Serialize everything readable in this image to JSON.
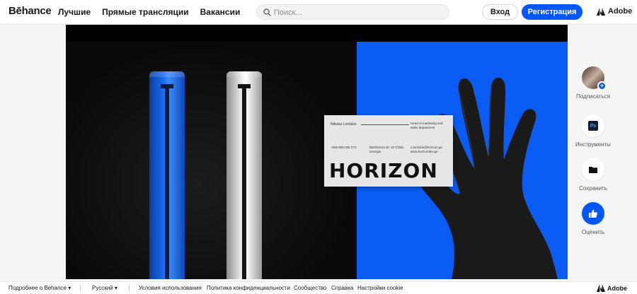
{
  "header": {
    "logo": "Bēhance",
    "nav": [
      "Лучшие",
      "Прямые трансляции",
      "Вакансии"
    ],
    "search_placeholder": "Поиск...",
    "login_label": "Вход",
    "register_label": "Регистрация",
    "adobe_label": "Adobe"
  },
  "artwork": {
    "card_name": "Nikolas Lomidze",
    "card_role": "Head of marketing and sales department",
    "card_phone": "+995 599 036 073",
    "card_address": "Batcherma str. 23 Tbilisi, Georgia",
    "card_email": "n.lomidze@horizon.ge www.horizondev.ge",
    "wordmark": "HORIZON"
  },
  "rail": {
    "follow": "Подписаться",
    "tools": "Инструменты",
    "tools_badge": "Ps",
    "save": "Сохранить",
    "appreciate": "Оценить"
  },
  "footer": {
    "more": "Подробнее о Behance",
    "language": "Русский",
    "links": [
      "Условия использования",
      "Политика конфиденциальности",
      "Сообщество",
      "Справка",
      "Настройки cookie"
    ],
    "adobe_label": "Adobe"
  },
  "colors": {
    "accent": "#0057ff",
    "artwork_blue": "#0a5cf5"
  }
}
